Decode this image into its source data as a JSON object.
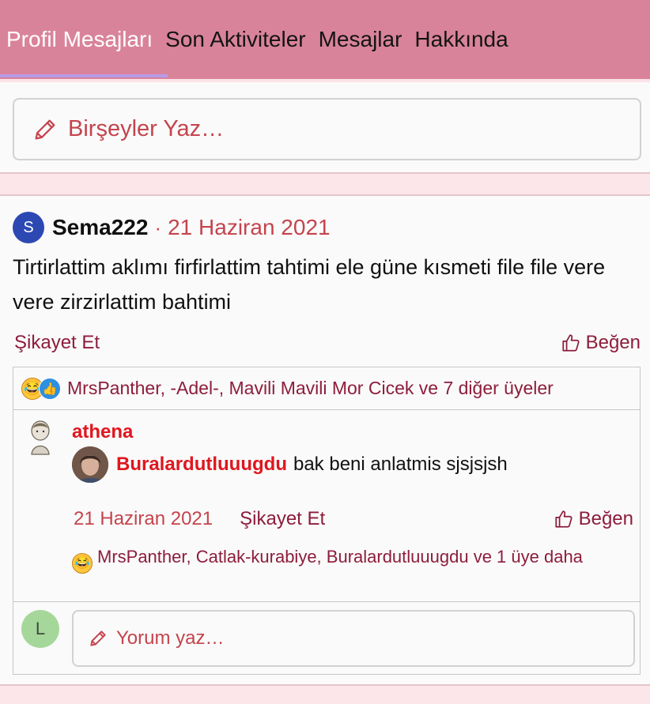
{
  "tabs": [
    {
      "label": "Profil Mesajları",
      "active": true
    },
    {
      "label": "Son Aktiviteler"
    },
    {
      "label": "Mesajlar"
    },
    {
      "label": "Hakkında"
    }
  ],
  "composer": {
    "placeholder": "Birşeyler Yaz…"
  },
  "post": {
    "avatar_letter": "S",
    "author": "Sema222",
    "separator": "·",
    "date": "21 Haziran 2021",
    "text": "Tirtirlattim aklımı firfirlattim tahtimi ele güne kısmeti file file vere vere zirzirlattim bahtimi",
    "report_label": "Şikayet Et",
    "like_label": "Beğen",
    "reactions_text": "MrsPanther, -Adel-, Mavili Mavili Mor Cicek ve 7 diğer üyeler"
  },
  "comment": {
    "author": "athena",
    "mention": "Buralardutluuugdu",
    "text": "bak beni anlatmis sjsjsjsh",
    "date": "21 Haziran 2021",
    "report_label": "Şikayet Et",
    "like_label": "Beğen",
    "reactions_text": "MrsPanther, Catlak-kurabiye, Buralardutluuugdu ve 1 üye daha"
  },
  "reply": {
    "avatar_letter": "L",
    "placeholder": "Yorum yaz…"
  },
  "colors": {
    "header_bg": "#d9839b",
    "accent_red": "#c4444d",
    "link": "#8d1d3c",
    "mention": "#e0161e",
    "avatar_s": "#2c48b3",
    "avatar_l": "#a5d79a"
  }
}
